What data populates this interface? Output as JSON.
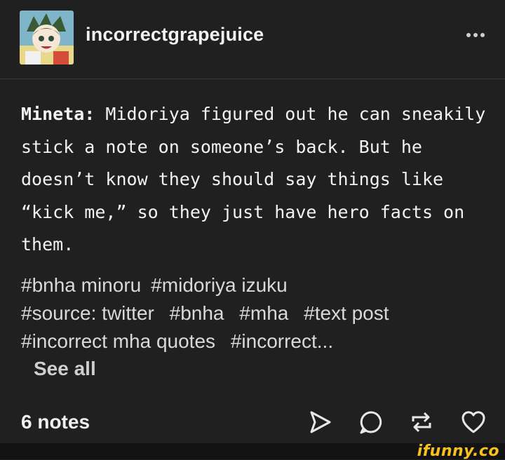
{
  "post": {
    "username": "incorrectgrapejuice",
    "speaker": "Mineta:",
    "text": "Midoriya figured out he can sneakily stick a note on someone’s back. But he doesn’t know they should say things like “kick me,” so they just have hero facts on them.",
    "tags": [
      "#bnha minoru",
      "#midoriya izuku",
      "#source: twitter",
      "#bnha",
      "#mha",
      "#text post",
      "#incorrect mha quotes",
      "#incorrect..."
    ],
    "see_all_label": "See all",
    "notes_label": "6 notes"
  },
  "icons": {
    "more": "more-dots-icon",
    "share": "send-icon",
    "reply": "reply-bubble-icon",
    "reblog": "reblog-icon",
    "like": "heart-icon"
  },
  "watermark": "ifunny.co",
  "colors": {
    "background": "#202020",
    "footer": "#131313",
    "watermark": "#f7c21b"
  }
}
